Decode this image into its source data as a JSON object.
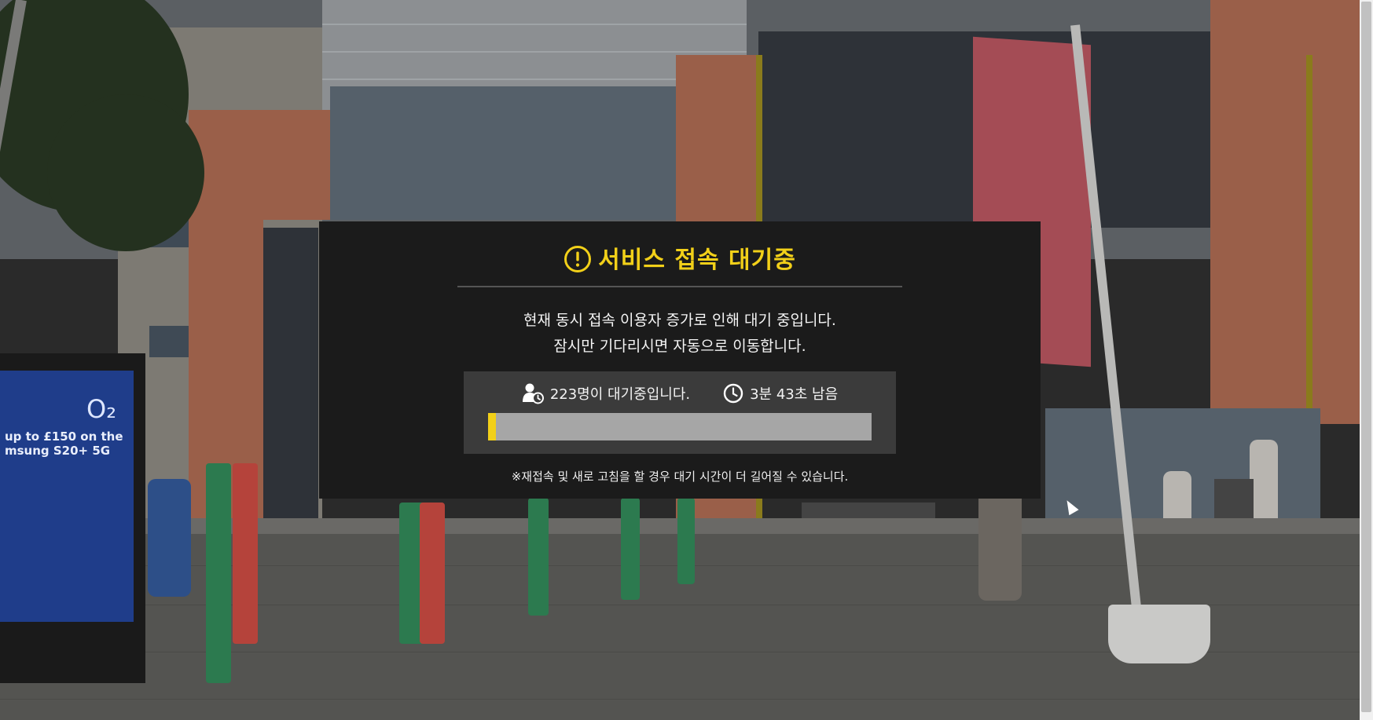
{
  "modal": {
    "title": "서비스 접속 대기중",
    "title_color": "#f2d019",
    "title_icon": "exclamation-circle-icon",
    "message_line1": "현재 동시 접속 이용자 증가로 인해 대기 중입니다.",
    "message_line2": "잠시만 기다리시면 자동으로 이동합니다.",
    "queue": {
      "waiting_text": "223명이 대기중입니다.",
      "waiting_icon": "user-clock-icon",
      "remaining_text": "3분 43초 남음",
      "remaining_icon": "clock-icon",
      "progress_percent": 2
    },
    "notice": "※재접속 및 새로 고침을 할 경우 대기 시간이 더 길어질 수 있습니다."
  },
  "background": {
    "kiosk_brand": "O₂",
    "kiosk_ad": "up to £150 on the\nmsung S20+ 5G",
    "accent_color": "#f2d019",
    "modal_background": "#1b1b1b"
  }
}
